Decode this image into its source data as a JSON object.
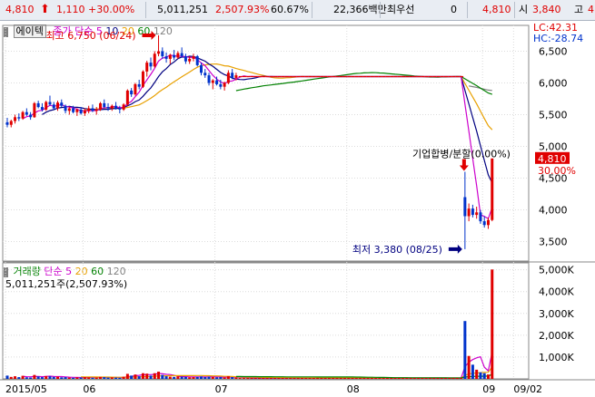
{
  "quote": {
    "price": "4,810",
    "change": "1,110",
    "change_rate": "+30.00%",
    "volume": "5,011,251",
    "volume_rate": "2,507.93%",
    "turnover_rate": "60.67%",
    "amount": "22,366백만",
    "preferred_label": "최우선",
    "preferred_value": "0",
    "best_price": "4,810",
    "open_label": "시",
    "open_value": "3,840",
    "high_label": "고",
    "high_value": "4"
  },
  "price_panel": {
    "stock_name": "에이텍",
    "ma_label": "종가 단순",
    "ma_periods": [
      "5",
      "10",
      "20",
      "60",
      "120"
    ],
    "lc_label": "LC:42.31",
    "hc_label": "HC:-28.74",
    "max_annotation": "최고 6,750 (06/24)",
    "min_annotation": "최저 3,380 (08/25)",
    "event_annotation": "기업합병/분할(0.00%)",
    "last_price_tag": "4,810",
    "last_rate_tag": "30.00%",
    "y_ticks": [
      "6,500",
      "6,000",
      "5,500",
      "5,000",
      "4,500",
      "4,000",
      "3,500"
    ]
  },
  "volume_panel": {
    "title": "거래량",
    "ma_label": "단순",
    "ma_periods": [
      "5",
      "20",
      "60",
      "120"
    ],
    "last_volume": "5,011,251주(2,507.93%)",
    "y_ticks": [
      "5,000K",
      "4,000K",
      "3,000K",
      "2,000K",
      "1,000K"
    ]
  },
  "x_axis": {
    "labels": [
      "2015/05",
      "06",
      "07",
      "08",
      "09",
      "09/02"
    ]
  },
  "colors": {
    "up": "#e00000",
    "down": "#0033cc",
    "ma5": "#cc00cc",
    "ma10": "#000080",
    "ma20": "#e8a000",
    "ma60": "#008000",
    "ma120": "#808080",
    "vol_ma5": "#cc00cc",
    "vol_ma20": "#e8a000",
    "vol_ma60": "#008000",
    "vol_ma120": "#808080"
  },
  "chart_data": {
    "type": "candlestick",
    "price_ylim": [
      3250,
      6850
    ],
    "volume_ylim": [
      0,
      5150000
    ],
    "x_labels": [
      {
        "label": "2015/05",
        "index": 0
      },
      {
        "label": "06",
        "index": 20
      },
      {
        "label": "07",
        "index": 54
      },
      {
        "label": "08",
        "index": 88
      },
      {
        "label": "09",
        "index": 123
      },
      {
        "label": "09/02",
        "index": 131
      }
    ],
    "candles": [
      [
        5380,
        5450,
        5300,
        5340,
        150000
      ],
      [
        5340,
        5420,
        5300,
        5400,
        90000
      ],
      [
        5400,
        5500,
        5360,
        5460,
        120000
      ],
      [
        5460,
        5520,
        5400,
        5440,
        80000
      ],
      [
        5440,
        5560,
        5420,
        5540,
        140000
      ],
      [
        5540,
        5600,
        5480,
        5500,
        70000
      ],
      [
        5500,
        5540,
        5420,
        5460,
        60000
      ],
      [
        5460,
        5700,
        5450,
        5680,
        180000
      ],
      [
        5680,
        5720,
        5600,
        5620,
        110000
      ],
      [
        5620,
        5680,
        5550,
        5580,
        80000
      ],
      [
        5580,
        5720,
        5560,
        5700,
        130000
      ],
      [
        5700,
        5800,
        5640,
        5660,
        120000
      ],
      [
        5660,
        5700,
        5580,
        5600,
        90000
      ],
      [
        5600,
        5720,
        5560,
        5690,
        100000
      ],
      [
        5690,
        5740,
        5620,
        5640,
        70000
      ],
      [
        5640,
        5660,
        5520,
        5560,
        80000
      ],
      [
        5560,
        5620,
        5500,
        5600,
        60000
      ],
      [
        5600,
        5640,
        5520,
        5540,
        50000
      ],
      [
        5540,
        5600,
        5480,
        5580,
        70000
      ],
      [
        5580,
        5620,
        5500,
        5520,
        60000
      ],
      [
        5520,
        5600,
        5480,
        5560,
        80000
      ],
      [
        5560,
        5640,
        5520,
        5600,
        70000
      ],
      [
        5600,
        5660,
        5540,
        5560,
        50000
      ],
      [
        5560,
        5620,
        5500,
        5580,
        60000
      ],
      [
        5580,
        5700,
        5560,
        5680,
        90000
      ],
      [
        5680,
        5740,
        5600,
        5620,
        80000
      ],
      [
        5620,
        5680,
        5560,
        5600,
        60000
      ],
      [
        5600,
        5660,
        5560,
        5640,
        70000
      ],
      [
        5640,
        5700,
        5580,
        5600,
        60000
      ],
      [
        5600,
        5640,
        5520,
        5580,
        50000
      ],
      [
        5580,
        5680,
        5560,
        5660,
        100000
      ],
      [
        5660,
        5900,
        5640,
        5880,
        230000
      ],
      [
        5880,
        5920,
        5780,
        5820,
        150000
      ],
      [
        5820,
        6000,
        5800,
        5980,
        200000
      ],
      [
        5980,
        6050,
        5900,
        5940,
        120000
      ],
      [
        5940,
        6200,
        5920,
        6180,
        260000
      ],
      [
        6180,
        6350,
        6100,
        6320,
        240000
      ],
      [
        6320,
        6400,
        6200,
        6260,
        150000
      ],
      [
        6260,
        6500,
        6240,
        6460,
        260000
      ],
      [
        6460,
        6750,
        6420,
        6500,
        330000
      ],
      [
        6500,
        6560,
        6380,
        6420,
        180000
      ],
      [
        6420,
        6480,
        6320,
        6380,
        120000
      ],
      [
        6380,
        6460,
        6300,
        6440,
        100000
      ],
      [
        6440,
        6520,
        6360,
        6400,
        90000
      ],
      [
        6400,
        6500,
        6380,
        6470,
        110000
      ],
      [
        6470,
        6560,
        6400,
        6420,
        100000
      ],
      [
        6420,
        6460,
        6300,
        6340,
        90000
      ],
      [
        6340,
        6420,
        6300,
        6380,
        70000
      ],
      [
        6380,
        6460,
        6340,
        6420,
        80000
      ],
      [
        6420,
        6440,
        6260,
        6280,
        90000
      ],
      [
        6280,
        6320,
        6120,
        6160,
        110000
      ],
      [
        6160,
        6220,
        6080,
        6120,
        80000
      ],
      [
        6120,
        6160,
        5960,
        6000,
        100000
      ],
      [
        6000,
        6060,
        5900,
        6040,
        90000
      ],
      [
        6040,
        6100,
        5960,
        5980,
        70000
      ],
      [
        5980,
        6050,
        5900,
        5940,
        80000
      ],
      [
        5940,
        6020,
        5880,
        6000,
        60000
      ],
      [
        6000,
        6200,
        5980,
        6160,
        120000
      ],
      [
        6160,
        6220,
        6060,
        6080,
        80000
      ],
      [
        6080,
        6160,
        6040,
        6120,
        60000
      ]
    ],
    "halt_start_index": 60,
    "halt_end_index": 117,
    "halt_price": 6100,
    "halt_volume": 40000,
    "post_candles": [
      {
        "i": 118,
        "o": 4200,
        "h": 4600,
        "l": 3380,
        "c": 3900,
        "v": 2650000
      },
      {
        "i": 119,
        "o": 3900,
        "h": 4100,
        "l": 3820,
        "c": 4020,
        "v": 1050000
      },
      {
        "i": 120,
        "o": 4020,
        "h": 4080,
        "l": 3880,
        "c": 3920,
        "v": 650000
      },
      {
        "i": 121,
        "o": 3920,
        "h": 4050,
        "l": 3860,
        "c": 3960,
        "v": 420000
      },
      {
        "i": 122,
        "o": 3960,
        "h": 4000,
        "l": 3780,
        "c": 3820,
        "v": 300000
      },
      {
        "i": 123,
        "o": 3820,
        "h": 3900,
        "l": 3720,
        "c": 3760,
        "v": 260000
      },
      {
        "i": 124,
        "o": 3760,
        "h": 3880,
        "l": 3700,
        "c": 3840,
        "v": 200000
      },
      {
        "i": 125,
        "o": 3840,
        "h": 4810,
        "l": 3820,
        "c": 4810,
        "v": 5011251
      }
    ]
  }
}
